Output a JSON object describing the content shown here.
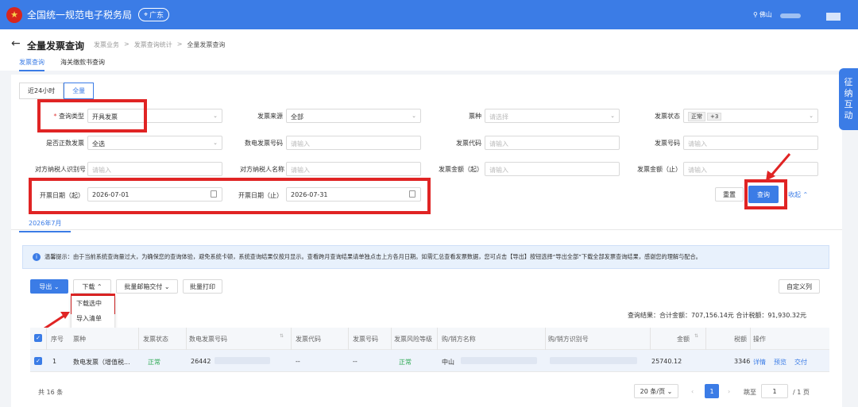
{
  "header": {
    "system_title": "全国统一规范电子税务局",
    "region": "广东",
    "user": "佛山"
  },
  "page": {
    "title": "全量发票查询",
    "breadcrumb": [
      "发票业务",
      "发票查询统计",
      "全量发票查询"
    ],
    "tabs": [
      "发票查询",
      "海关缴款书查询"
    ]
  },
  "range_toggle": [
    "近24小时",
    "全量"
  ],
  "filters": {
    "query_type": {
      "label": "查询类型",
      "value": "开具发票"
    },
    "invoice_source": {
      "label": "发票来源",
      "value": "全部"
    },
    "invoice_kind": {
      "label": "票种",
      "placeholder": "请选择"
    },
    "invoice_status": {
      "label": "发票状态",
      "tag": "正常",
      "more": "+3"
    },
    "is_positive": {
      "label": "是否正数发票",
      "value": "全选"
    },
    "digital_no": {
      "label": "数电发票号码",
      "placeholder": "请输入"
    },
    "invoice_code": {
      "label": "发票代码",
      "placeholder": "请输入"
    },
    "invoice_no": {
      "label": "发票号码",
      "placeholder": "请输入"
    },
    "counterpart_id": {
      "label": "对方纳税人识别号",
      "placeholder": "请输入"
    },
    "counterpart_name": {
      "label": "对方纳税人名称",
      "placeholder": "请输入"
    },
    "amount_from": {
      "label": "发票金额（起）",
      "placeholder": "请输入"
    },
    "amount_to": {
      "label": "发票金额（止）",
      "placeholder": "请输入"
    },
    "date_from": {
      "label": "开票日期（起）",
      "value": "2026-07-01"
    },
    "date_to": {
      "label": "开票日期（止）",
      "value": "2026-07-31"
    }
  },
  "actions": {
    "reset": "重置",
    "search": "查询",
    "collapse": "收起"
  },
  "month_tab": "2026年7月",
  "notice": "温馨提示：由于当前系统查询量过大，为确保您的查询体验，避免系统卡顿，系统查询结果仅按月显示。查看跨月查询结果请单独点击上方各月日期。如需汇总查看发票数据，您可点击【导出】按钮选择“导出全部”下载全部发票查询结果，感谢您的理解与配合。",
  "toolbar": {
    "export": "导出",
    "download": "下载",
    "batch_delivery": "批量邮箱交付",
    "batch_print": "批量打印",
    "custom_columns": "自定义列"
  },
  "download_menu": [
    "下载选中",
    "导入清单"
  ],
  "summary": "查询结果：合计金额：707,156.14元    合计税额：91,930.32元",
  "table": {
    "columns": [
      "序号",
      "票种",
      "发票状态",
      "数电发票号码",
      "发票代码",
      "发票号码",
      "发票风险等级",
      "购/销方名称",
      "购/销方识别号",
      "金额",
      "税额",
      "操作"
    ],
    "rows": [
      {
        "index": "1",
        "kind": "数电发票（增值税...",
        "status": "正常",
        "digital_no": "26442",
        "code": "--",
        "no": "--",
        "risk": "正常",
        "party": "中山",
        "amount": "25740.12",
        "tax": "3346",
        "ops": [
          "详情",
          "预览",
          "交付"
        ]
      }
    ]
  },
  "pagination": {
    "total": "共 16 条",
    "page_size": "20 条/页",
    "current": "1",
    "goto_label": "跳至",
    "goto_value": "1",
    "pages": "/ 1 页"
  },
  "side_widget": [
    "征",
    "纳",
    "互",
    "动"
  ],
  "colors": {
    "primary": "#3b7ce6",
    "annotation_red": "#e02424",
    "status_green": "#2faa55"
  }
}
